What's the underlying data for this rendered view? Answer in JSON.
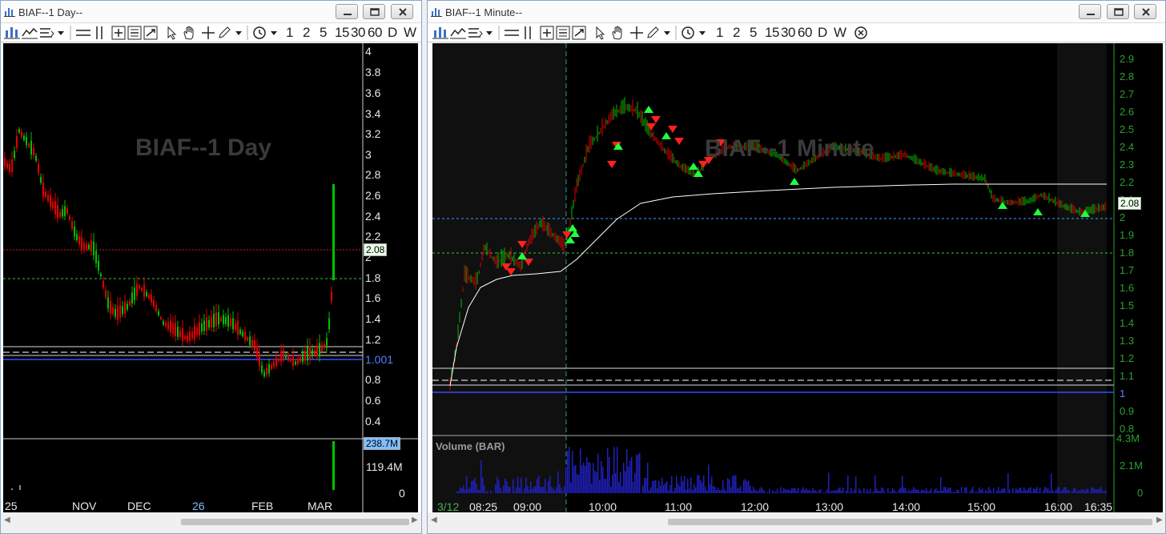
{
  "left_window": {
    "title": "BIAF--1 Day--",
    "watermark": "BIAF--1 Day",
    "toolbar_periods": [
      "1",
      "2",
      "5",
      "15",
      "30",
      "60",
      "D",
      "W"
    ],
    "y_ticks": [
      "4",
      "3.8",
      "3.6",
      "3.4",
      "3.2",
      "3",
      "2.8",
      "2.6",
      "2.4",
      "2.2",
      "2",
      "1.8",
      "1.6",
      "1.4",
      "1.2",
      "1.001",
      "0.8",
      "0.6",
      "0.4"
    ],
    "price_tag": "2.08",
    "volume_ticks": [
      "238.7M",
      "119.4M",
      "0"
    ],
    "x_ticks": [
      "25",
      "NOV",
      "DEC",
      "26",
      "FEB",
      "MAR"
    ]
  },
  "right_window": {
    "title": "BIAF--1 Minute--",
    "watermark": "BIAF--1 Minute",
    "toolbar_periods": [
      "1",
      "2",
      "5",
      "15",
      "30",
      "60",
      "D",
      "W"
    ],
    "y_ticks": [
      "2.9",
      "2.8",
      "2.7",
      "2.6",
      "2.5",
      "2.4",
      "2.3",
      "2.2",
      "2.1",
      "2",
      "1.9",
      "1.8",
      "1.7",
      "1.6",
      "1.5",
      "1.4",
      "1.3",
      "1.2",
      "1.1",
      "1",
      "0.9",
      "0.8"
    ],
    "price_tag": "2.08",
    "volume_label": "Volume (BAR)",
    "volume_ticks": [
      "4.3M",
      "2.1M",
      "0"
    ],
    "x_ticks": [
      "3/12",
      "08:25",
      "09:00",
      "10:00",
      "11:00",
      "12:00",
      "13:00",
      "14:00",
      "15:00",
      "16:00",
      "16:35"
    ]
  },
  "colors": {
    "chart_bg": "#000000",
    "up_candle": "#00c000",
    "down_candle": "#e00000",
    "vwap": "#ffffff",
    "level_green": "#2ecc40",
    "level_red": "#cc2020",
    "level_blue": "#3050ff",
    "volume": "#2020c0"
  }
}
